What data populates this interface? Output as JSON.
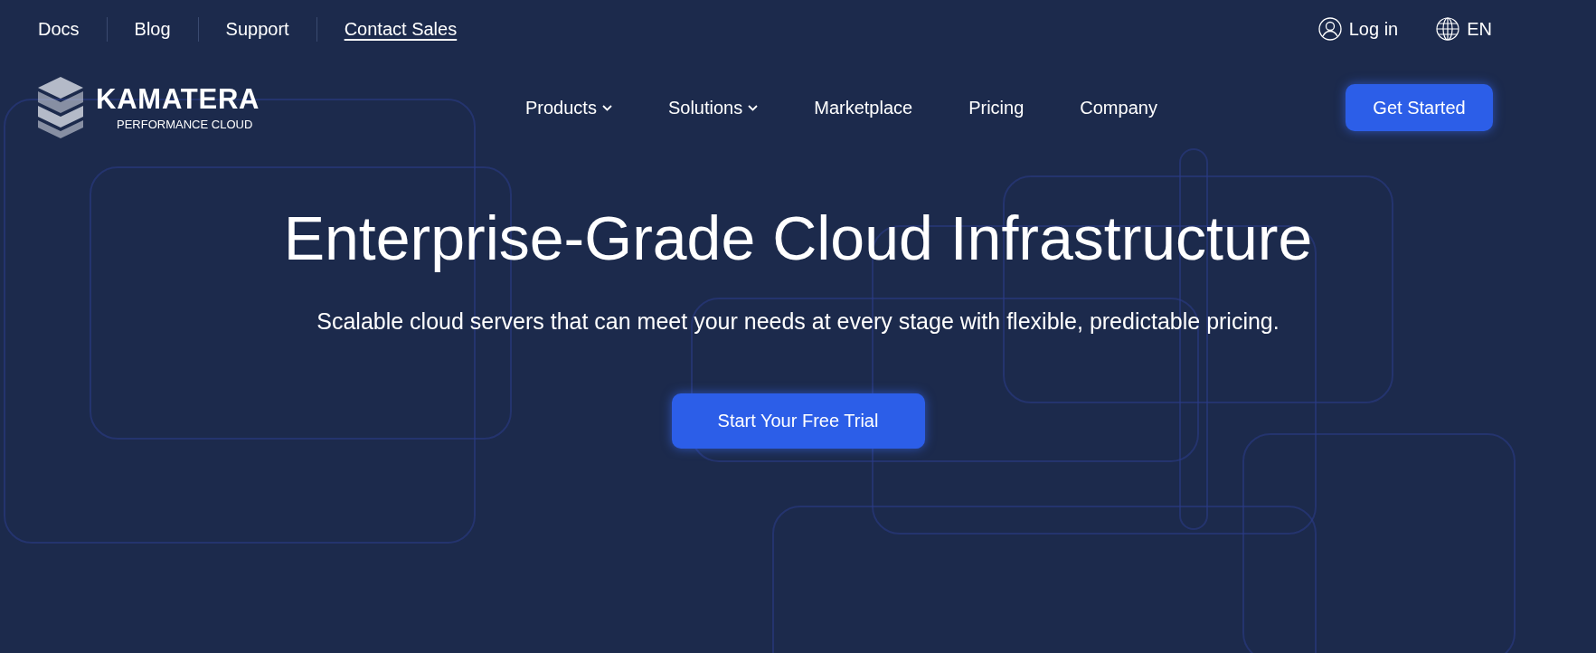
{
  "top_bar": {
    "links": [
      {
        "label": "Docs",
        "underlined": false
      },
      {
        "label": "Blog",
        "underlined": false
      },
      {
        "label": "Support",
        "underlined": false
      },
      {
        "label": "Contact Sales",
        "underlined": true
      }
    ],
    "login": "Log in",
    "language": "EN"
  },
  "header": {
    "logo": {
      "name": "KAMATERA",
      "tagline": "PERFORMANCE CLOUD"
    },
    "nav": [
      {
        "label": "Products",
        "has_dropdown": true
      },
      {
        "label": "Solutions",
        "has_dropdown": true
      },
      {
        "label": "Marketplace",
        "has_dropdown": false
      },
      {
        "label": "Pricing",
        "has_dropdown": false
      },
      {
        "label": "Company",
        "has_dropdown": false
      }
    ],
    "cta": "Get Started"
  },
  "hero": {
    "title": "Enterprise-Grade Cloud Infrastructure",
    "subtitle": "Scalable cloud servers that can meet your needs at every stage with flexible, predictable pricing.",
    "cta": "Start Your Free Trial"
  }
}
